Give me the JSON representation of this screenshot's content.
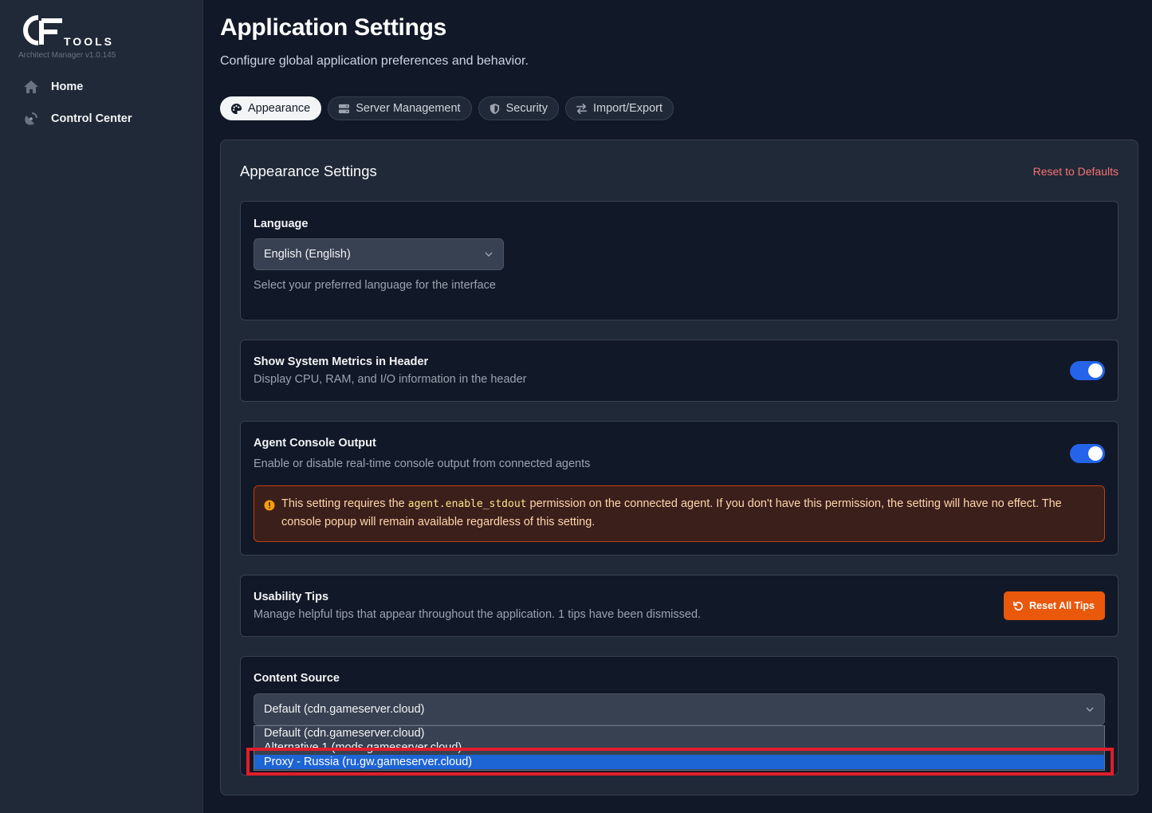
{
  "app": {
    "logo_text": "TOOLS",
    "version": "Architect Manager v1.0.145"
  },
  "sidebar": {
    "items": [
      {
        "label": "Home",
        "icon": "home-icon"
      },
      {
        "label": "Control Center",
        "icon": "satellite-icon"
      }
    ]
  },
  "header": {
    "title": "Application Settings",
    "subtitle": "Configure global application preferences and behavior."
  },
  "tabs": [
    {
      "label": "Appearance",
      "icon": "palette-icon",
      "active": true
    },
    {
      "label": "Server Management",
      "icon": "server-icon",
      "active": false
    },
    {
      "label": "Security",
      "icon": "shield-icon",
      "active": false
    },
    {
      "label": "Import/Export",
      "icon": "swap-icon",
      "active": false
    }
  ],
  "panel": {
    "title": "Appearance Settings",
    "reset_defaults": "Reset to Defaults"
  },
  "language": {
    "label": "Language",
    "value": "English (English)",
    "help": "Select your preferred language for the interface"
  },
  "metrics": {
    "label": "Show System Metrics in Header",
    "desc": "Display CPU, RAM, and I/O information in the header",
    "enabled": true
  },
  "console": {
    "label": "Agent Console Output",
    "desc": "Enable or disable real-time console output from connected agents",
    "enabled": true,
    "warning_pre": "This setting requires the ",
    "warning_code": "agent.enable_stdout",
    "warning_post": " permission on the connected agent. If you don't have this permission, the setting will have no effect. The console popup will remain available regardless of this setting."
  },
  "tips": {
    "label": "Usability Tips",
    "desc": "Manage helpful tips that appear throughout the application. 1 tips have been dismissed.",
    "button": "Reset All Tips"
  },
  "content_source": {
    "label": "Content Source",
    "value": "Default (cdn.gameserver.cloud)",
    "options": [
      "Default (cdn.gameserver.cloud)",
      "Alternative 1 (mods.gameserver.cloud)",
      "Proxy - Russia (ru.gw.gameserver.cloud)"
    ]
  },
  "colors": {
    "accent": "#2563eb",
    "danger": "#f87171",
    "warning": "#ea580c",
    "highlight": "#e11d2a"
  }
}
